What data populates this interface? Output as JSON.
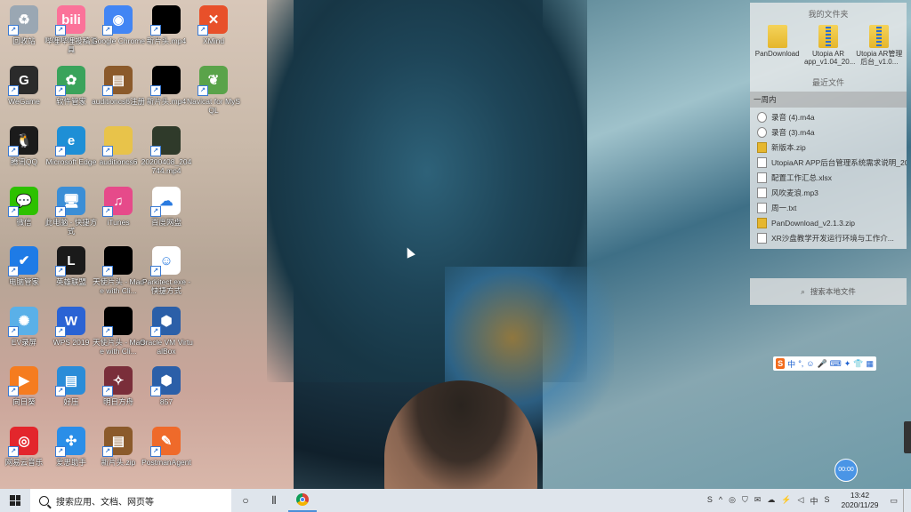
{
  "desktop_icons": [
    {
      "label": "回收站",
      "icon": "recycle-bin-icon",
      "color": "#9aa7b3",
      "glyph": "♻"
    },
    {
      "label": "哔哩哔哩投稿工具",
      "icon": "bilibili-icon",
      "color": "#fb7299",
      "glyph": "bili"
    },
    {
      "label": "Google Chrome",
      "icon": "chrome-icon",
      "color": "#4285f4",
      "glyph": "◉"
    },
    {
      "label": "新片头.mp4",
      "icon": "video-thumbnail-icon",
      "color": "#000000",
      "glyph": ""
    },
    {
      "label": "XMind",
      "icon": "xmind-icon",
      "color": "#e8502a",
      "glyph": "✕"
    },
    {
      "label": "WeGame",
      "icon": "wegame-icon",
      "color": "#2b2b2b",
      "glyph": "G"
    },
    {
      "label": "软件管家",
      "icon": "software-manager-icon",
      "color": "#3aa35b",
      "glyph": "✿"
    },
    {
      "label": "auditioncs6注册",
      "icon": "winrar-icon",
      "color": "#8b5a2b",
      "glyph": "▤"
    },
    {
      "label": "新片头.mp4",
      "icon": "video-thumbnail-icon",
      "color": "#000000",
      "glyph": ""
    },
    {
      "label": "Navicat for MySQL",
      "icon": "navicat-icon",
      "color": "#5aa34a",
      "glyph": "❦"
    },
    {
      "label": "腾讯QQ",
      "icon": "qq-icon",
      "color": "#1b1b1b",
      "glyph": "🐧"
    },
    {
      "label": "Microsoft Edge",
      "icon": "edge-icon",
      "color": "#1e8fd6",
      "glyph": "e"
    },
    {
      "label": "auditioncs6",
      "icon": "folder-icon",
      "color": "#e8c34a",
      "glyph": ""
    },
    {
      "label": "20200408_204744.mp4",
      "icon": "video-thumbnail-icon",
      "color": "#2f3a2a",
      "glyph": ""
    },
    {
      "label": "微信",
      "icon": "wechat-icon",
      "color": "#2dc100",
      "glyph": "💬"
    },
    {
      "label": "此电脑 - 快捷方式",
      "icon": "this-pc-icon",
      "color": "#3b8ed6",
      "glyph": "🖥"
    },
    {
      "label": "iTunes",
      "icon": "itunes-icon",
      "color": "#e64a8a",
      "glyph": "♫"
    },
    {
      "label": "百度网盘",
      "icon": "baidu-netdisk-icon",
      "color": "#ffffff",
      "glyph": "☁"
    },
    {
      "label": "电脑管家",
      "icon": "pc-manager-icon",
      "color": "#1e7be6",
      "glyph": "✔"
    },
    {
      "label": "英雄联盟",
      "icon": "league-of-legends-icon",
      "color": "#1a1a1a",
      "glyph": "L"
    },
    {
      "label": "天使片头 - Made with Cli...",
      "icon": "video-thumbnail-icon",
      "color": "#000000",
      "glyph": ""
    },
    {
      "label": "Parkitect.exe - 快捷方式",
      "icon": "parkitect-icon",
      "color": "#ffffff",
      "glyph": "☺"
    },
    {
      "label": "EV录屏",
      "icon": "ev-recorder-icon",
      "color": "#5ab0e8",
      "glyph": "✺"
    },
    {
      "label": "WPS 2019",
      "icon": "wps-icon",
      "color": "#2a63d4",
      "glyph": "W"
    },
    {
      "label": "天使片头 - Made with Cli...",
      "icon": "video-thumbnail-icon",
      "color": "#000000",
      "glyph": ""
    },
    {
      "label": "Oracle VM VirtualBox",
      "icon": "virtualbox-icon",
      "color": "#2b5fa8",
      "glyph": "⬢"
    },
    {
      "label": "向日葵",
      "icon": "sunflower-icon",
      "color": "#f57c1f",
      "glyph": "▶"
    },
    {
      "label": "好压",
      "icon": "haozip-icon",
      "color": "#2a8cd8",
      "glyph": "▤"
    },
    {
      "label": "明日方舟",
      "icon": "arknights-icon",
      "color": "#7a2e3a",
      "glyph": "✧"
    },
    {
      "label": "857",
      "icon": "virtualbox-icon",
      "color": "#2b5fa8",
      "glyph": "⬢"
    },
    {
      "label": "网易云音乐",
      "icon": "netease-music-icon",
      "color": "#e3262c",
      "glyph": "◎"
    },
    {
      "label": "爱思助手",
      "icon": "i4-assistant-icon",
      "color": "#2a8ee8",
      "glyph": "✣"
    },
    {
      "label": "新片头.zip",
      "icon": "winrar-icon",
      "color": "#8b5a2b",
      "glyph": "▤"
    },
    {
      "label": "PostmanAgent",
      "icon": "postman-icon",
      "color": "#ef6a2a",
      "glyph": "✎"
    }
  ],
  "panel": {
    "favorites_title": "我的文件夹",
    "favorites": [
      {
        "name": "PanDownload",
        "type": "folder"
      },
      {
        "name": "Utopia AR app_v1.04_20...",
        "type": "zip"
      },
      {
        "name": "Utopia AR管理后台_v1.0...",
        "type": "zip"
      }
    ],
    "recent_title": "最近文件",
    "group_label": "一周内",
    "recent_files": [
      {
        "name": "录音 (4).m4a",
        "type": "audio"
      },
      {
        "name": "录音 (3).m4a",
        "type": "audio"
      },
      {
        "name": "新版本.zip",
        "type": "zip"
      },
      {
        "name": "UtopiaAR APP后台管理系统需求说明_202...",
        "type": "doc"
      },
      {
        "name": "配置工作汇总.xlsx",
        "type": "doc"
      },
      {
        "name": "风吹麦浪.mp3",
        "type": "doc"
      },
      {
        "name": "周一.txt",
        "type": "doc"
      },
      {
        "name": "PanDownload_v2.1.3.zip",
        "type": "zip"
      },
      {
        "name": "XR沙盘教学开发运行环境与工作介...",
        "type": "doc"
      }
    ],
    "search_label": "搜索本地文件"
  },
  "ime": {
    "items": [
      "中",
      "°,",
      "☺",
      "🎤",
      "⌨",
      "✦",
      "👕",
      "▦"
    ]
  },
  "clock_bubble": "00:00",
  "taskbar": {
    "search_placeholder": "搜索应用、文档、网页等",
    "cortana": "○",
    "task_view": "⫴",
    "tray_icons": [
      "S",
      "^",
      "◎",
      "⛉",
      "✉",
      "☁",
      "⚡",
      "◁",
      "中",
      "S"
    ],
    "time": "13:42",
    "date": "2020/11/29"
  }
}
